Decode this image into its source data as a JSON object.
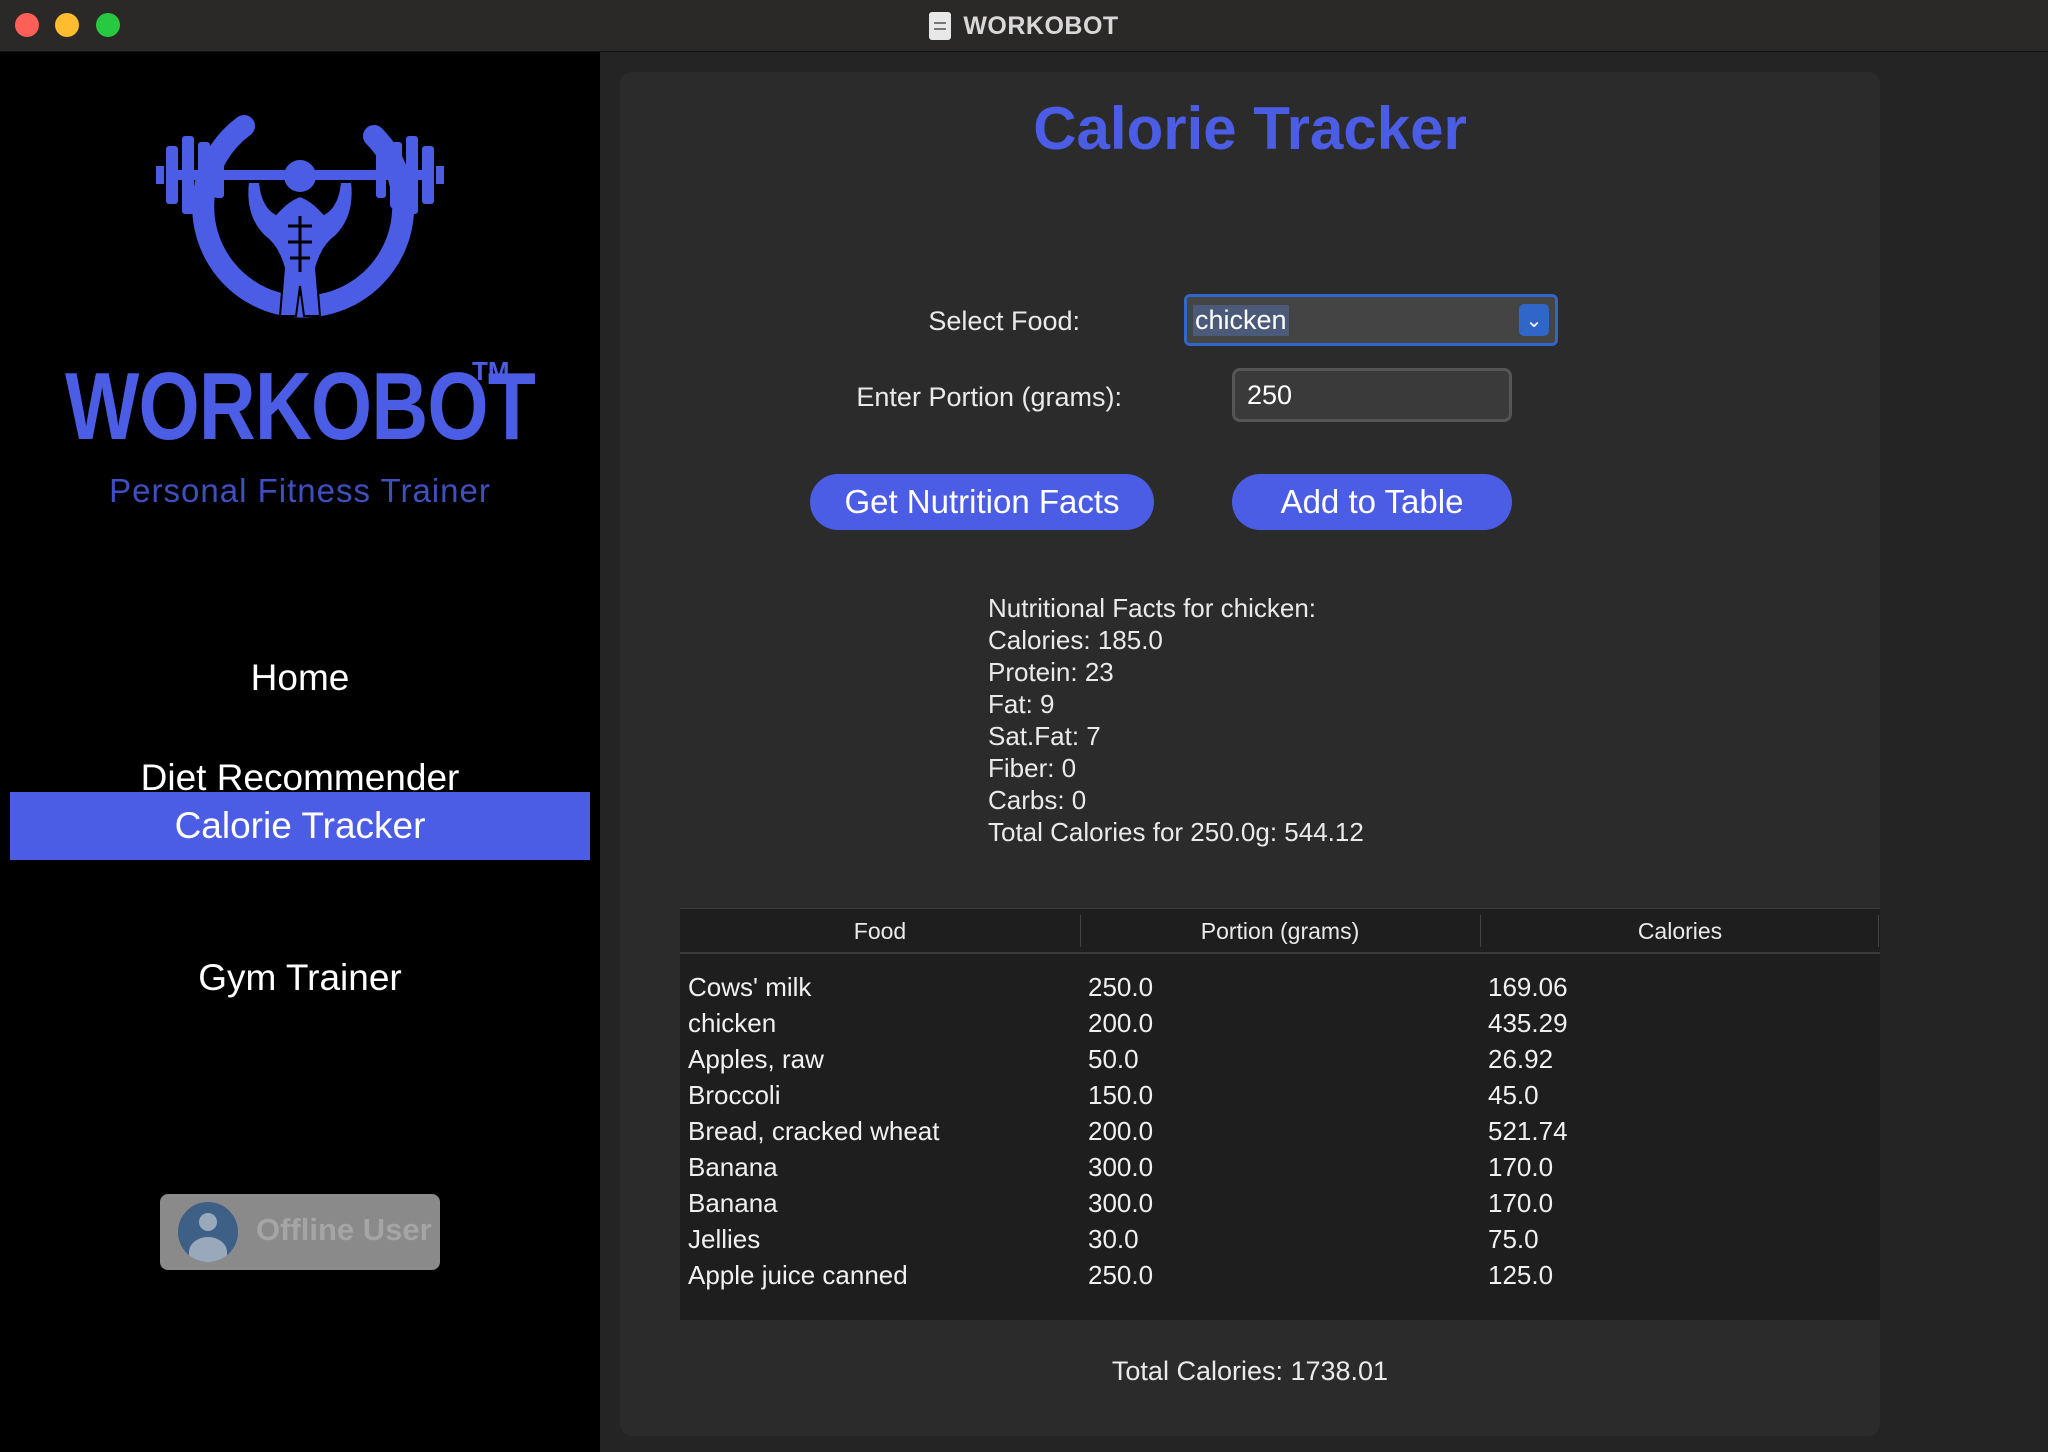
{
  "window": {
    "title": "WORKOBOT"
  },
  "sidebar": {
    "brand": "WORKOBOT",
    "trademark": "TM",
    "tagline": "Personal Fitness Trainer",
    "nav": [
      {
        "label": "Home",
        "active": false
      },
      {
        "label": "Diet Recommender",
        "active": false
      },
      {
        "label": "Calorie Tracker",
        "active": true
      },
      {
        "label": "Gym Trainer",
        "active": false
      }
    ],
    "user_label": "Offline User"
  },
  "main": {
    "title": "Calorie Tracker",
    "select_food_label": "Select Food:",
    "select_food_value": "chicken",
    "portion_label": "Enter Portion (grams):",
    "portion_value": "250",
    "get_facts_button": "Get Nutrition Facts",
    "add_button": "Add to Table",
    "facts": [
      "Nutritional Facts for chicken:",
      "Calories: 185.0",
      "Protein: 23",
      "Fat: 9",
      "Sat.Fat: 7",
      "Fiber: 0",
      "Carbs: 0",
      "Total Calories for 250.0g: 544.12"
    ],
    "table": {
      "columns": [
        "Food",
        "Portion (grams)",
        "Calories"
      ],
      "rows": [
        [
          "Cows' milk",
          "250.0",
          "169.06"
        ],
        [
          "chicken",
          "200.0",
          "435.29"
        ],
        [
          "Apples, raw",
          "50.0",
          "26.92"
        ],
        [
          "Broccoli",
          "150.0",
          "45.0"
        ],
        [
          "Bread, cracked wheat",
          "200.0",
          "521.74"
        ],
        [
          "Banana",
          "300.0",
          "170.0"
        ],
        [
          "Banana",
          "300.0",
          "170.0"
        ],
        [
          "Jellies",
          "30.0",
          "75.0"
        ],
        [
          "Apple juice canned",
          "250.0",
          "125.0"
        ]
      ]
    },
    "total_calories": "Total Calories: 1738.01"
  },
  "colors": {
    "accent": "#4b5de4",
    "sidebar_bg": "#000000",
    "panel_bg": "#2b2b2b"
  }
}
